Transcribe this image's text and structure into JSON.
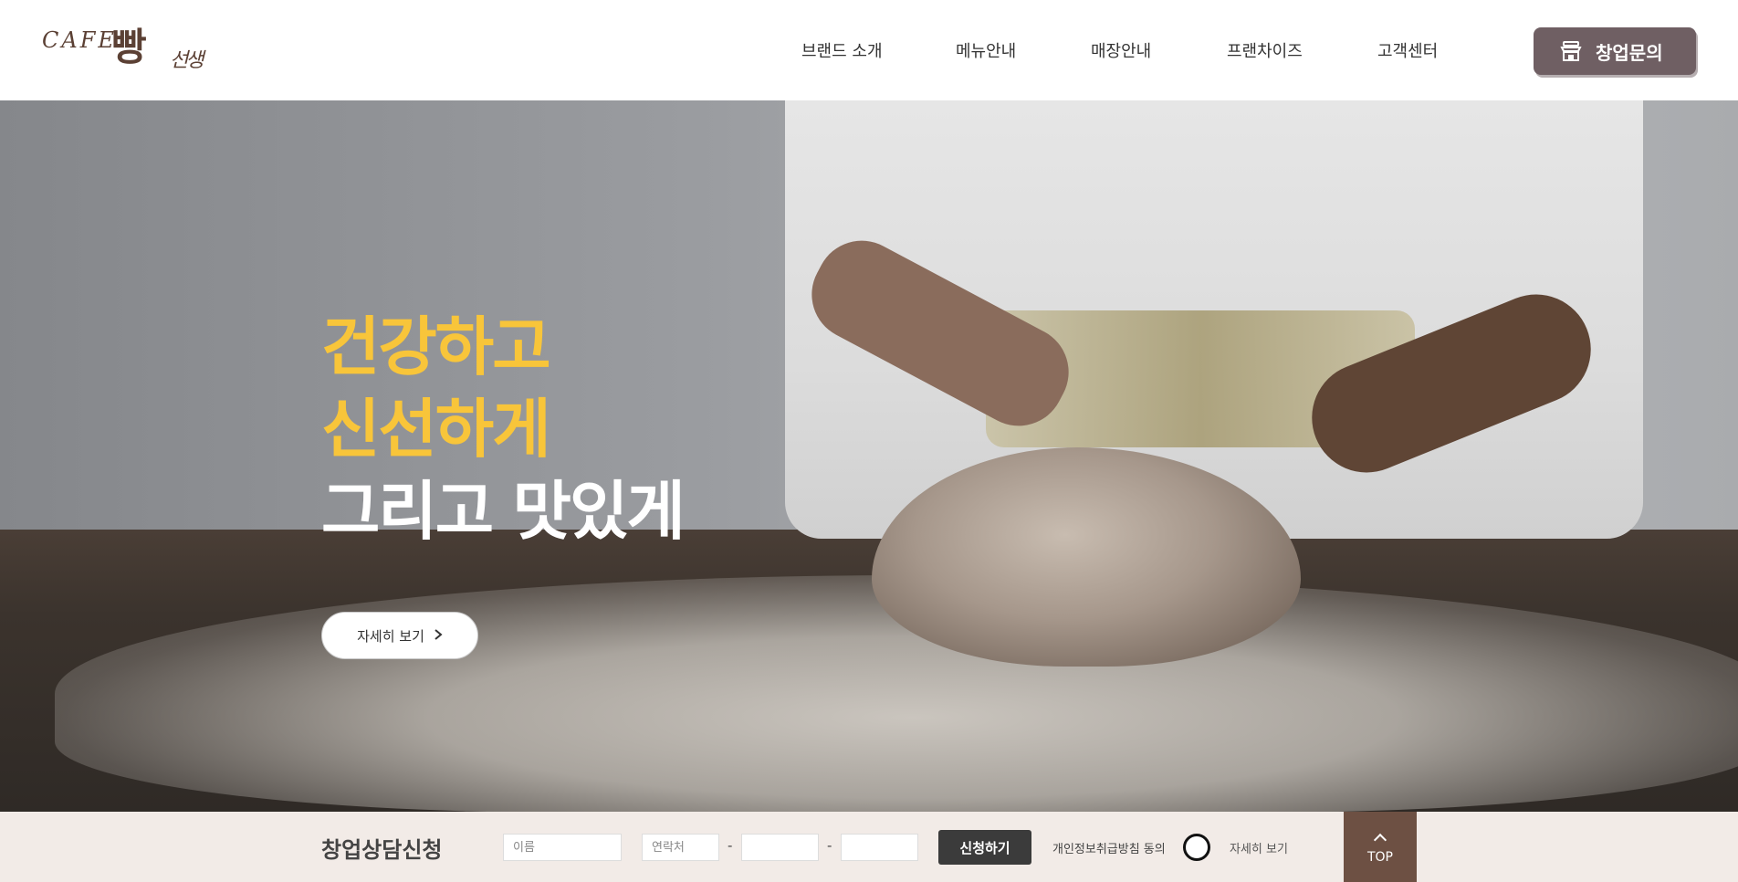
{
  "header": {
    "logo": {
      "cafe": "CAFE",
      "main": "빵",
      "sub": "선생"
    },
    "nav": [
      {
        "label": "브랜드 소개"
      },
      {
        "label": "메뉴안내"
      },
      {
        "label": "매장안내"
      },
      {
        "label": "프랜차이즈"
      },
      {
        "label": "고객센터"
      }
    ],
    "cta": {
      "label": "창업문의",
      "icon": "store-icon"
    }
  },
  "hero": {
    "lines": [
      "건강하고",
      "신선하게",
      "그리고 맛있게"
    ],
    "more_button": {
      "label": "자세히 보기",
      "icon": "chevron-right-icon"
    }
  },
  "consult_bar": {
    "title": "창업상담신청",
    "name_placeholder": "이름",
    "phone_placeholder": "연락처",
    "dash": "-",
    "submit_label": "신청하기",
    "agree_label": "개인정보취급방침 동의",
    "agree_more": "자세히 보기"
  },
  "top_button": {
    "label": "TOP",
    "icon": "chevron-up-icon"
  },
  "colors": {
    "brand_brown": "#6d5043",
    "cta_mauve": "#6f5f63",
    "hero_yellow": "#f8c53a",
    "bar_bg": "#f2ebe7"
  }
}
